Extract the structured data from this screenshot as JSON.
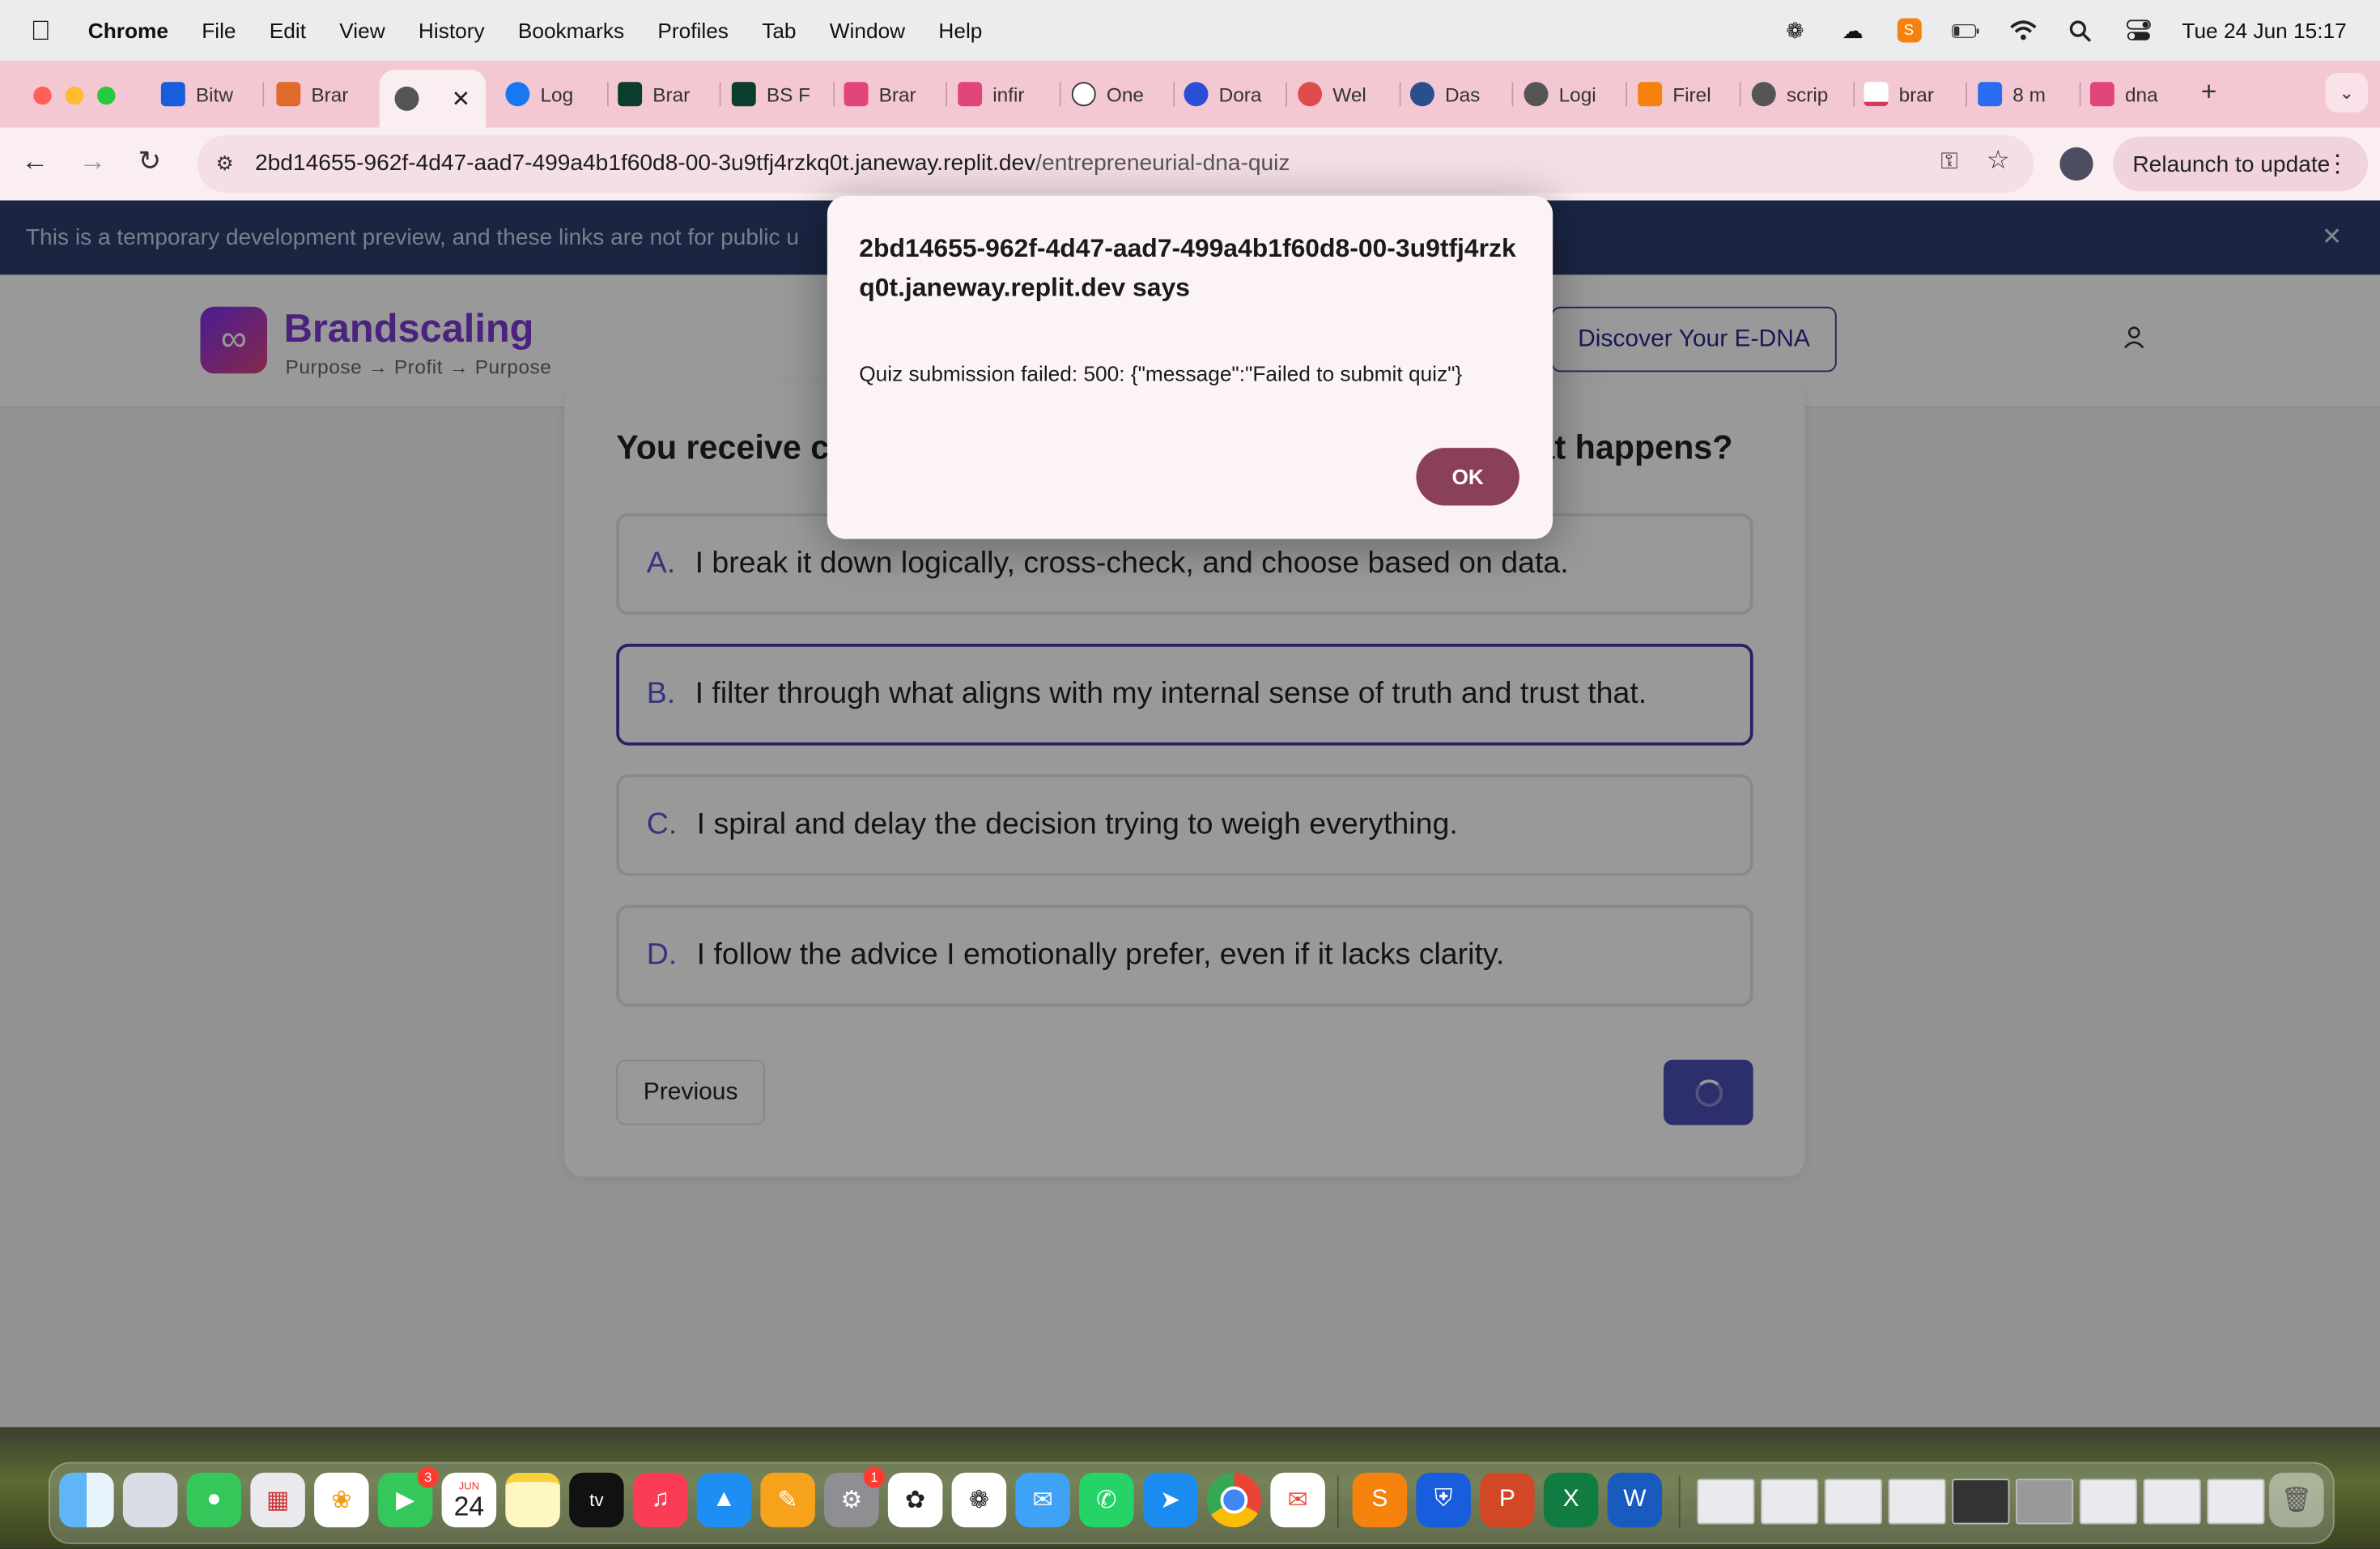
{
  "menubar": {
    "app": "Chrome",
    "items": [
      "File",
      "Edit",
      "View",
      "History",
      "Bookmarks",
      "Profiles",
      "Tab",
      "Window",
      "Help"
    ],
    "clock": "Tue 24 Jun  15:17"
  },
  "tabs": [
    {
      "label": "Bitw",
      "color": "#175DDC"
    },
    {
      "label": "Brar",
      "color": "#e06a2c"
    },
    {
      "label": "",
      "color": "#555555",
      "active": true
    },
    {
      "label": "Log",
      "color": "#1877F2"
    },
    {
      "label": "Brar",
      "color": "#0b3d2e"
    },
    {
      "label": "BS F",
      "color": "#0b3d2e"
    },
    {
      "label": "Brar",
      "color": "#e0457b"
    },
    {
      "label": "infir",
      "color": "#e0457b"
    },
    {
      "label": "One",
      "color": "#333333"
    },
    {
      "label": "Dora",
      "color": "#2a4fd6"
    },
    {
      "label": "Wel",
      "color": "#e04b4b"
    },
    {
      "label": "Das",
      "color": "#2a4f8f"
    },
    {
      "label": "Logi",
      "color": "#555555"
    },
    {
      "label": "Firel",
      "color": "#f5820d"
    },
    {
      "label": "scrip",
      "color": "#555555"
    },
    {
      "label": "brar",
      "color": "#d63a5a"
    },
    {
      "label": "8 m",
      "color": "#2a6cf0"
    },
    {
      "label": "dna",
      "color": "#e0457b"
    }
  ],
  "toolbar": {
    "url_host": "2bd14655-962f-4d47-aad7-499a4b1f60d8-00-3u9tfj4rzkq0t.janeway.replit.dev",
    "url_path": "/entrepreneurial-dna-quiz",
    "relaunch": "Relaunch to update"
  },
  "banner": {
    "text": "This is a temporary development preview, and these links are not for public u"
  },
  "header": {
    "brand": "Brandscaling",
    "tagline": "Purpose → Profit → Purpose",
    "cta": "Discover Your E-DNA"
  },
  "quiz": {
    "question_start": "You receive co",
    "question_end": "at happens?",
    "options": [
      {
        "letter": "A.",
        "text": "I break it down logically, cross-check, and choose based on data.",
        "selected": false
      },
      {
        "letter": "B.",
        "text": "I filter through what aligns with my internal sense of truth and trust that.",
        "selected": true
      },
      {
        "letter": "C.",
        "text": "I spiral and delay the decision trying to weigh everything.",
        "selected": false
      },
      {
        "letter": "D.",
        "text": "I follow the advice I emotionally prefer, even if it lacks clarity.",
        "selected": false
      }
    ],
    "previous": "Previous"
  },
  "dialog": {
    "title": "2bd14655-962f-4d47-aad7-499a4b1f60d8-00-3u9tfj4rzkq0t.janeway.replit.dev says",
    "message": "Quiz submission failed: 500: {\"message\":\"Failed to submit quiz\"}",
    "ok": "OK"
  },
  "dock": {
    "calendar_month": "JUN",
    "calendar_day": "24",
    "facetime_badge": "3",
    "settings_badge": "1",
    "apps": [
      "finder",
      "preview",
      "messages",
      "launchpad",
      "photos",
      "facetime",
      "calendar",
      "notes",
      "tv",
      "music",
      "keynote",
      "pages",
      "settings",
      "chatgpt-alt",
      "chatgpt",
      "mail",
      "whatsapp",
      "safari",
      "chrome",
      "airmail",
      "sublime",
      "bitwarden",
      "powerpoint",
      "excel",
      "word"
    ]
  }
}
